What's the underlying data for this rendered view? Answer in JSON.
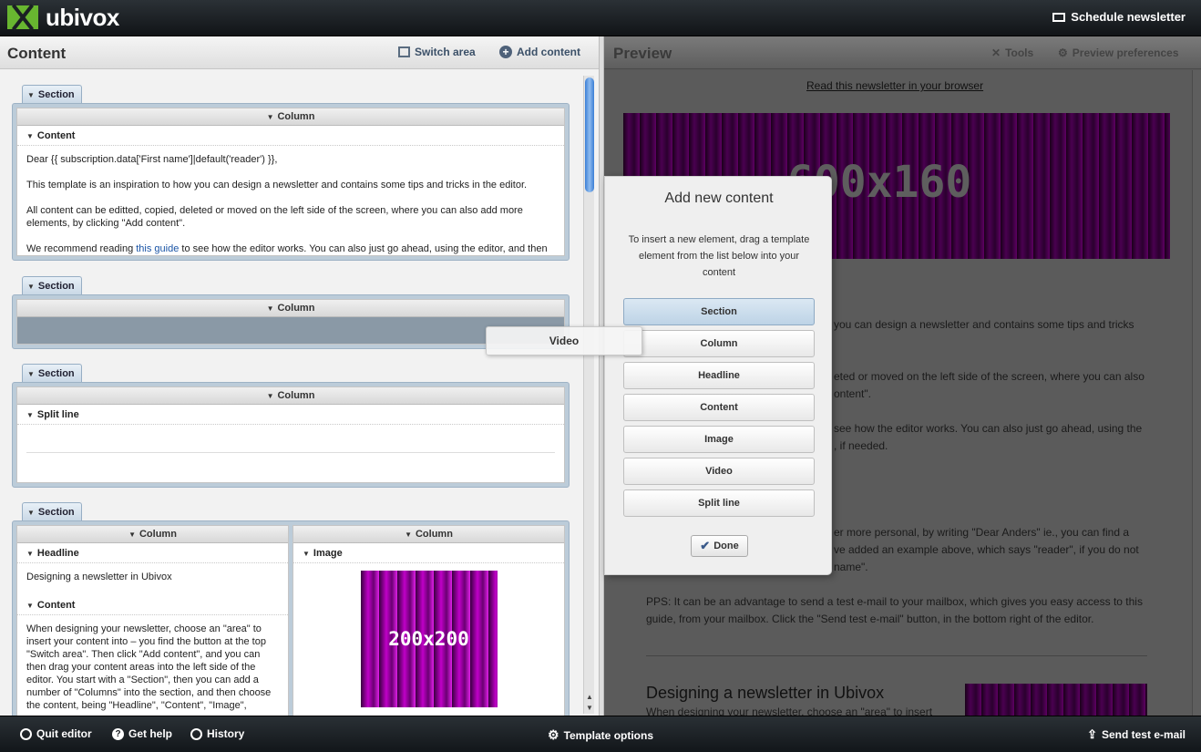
{
  "topbar": {
    "logo_text": "ubivox",
    "schedule_label": "Schedule newsletter"
  },
  "content_pane": {
    "title": "Content",
    "switch_area_label": "Switch area",
    "add_content_label": "Add content",
    "section_label": "Section",
    "column_label": "Column",
    "sections": {
      "s1": {
        "element_label": "Content",
        "para1": "Dear {{ subscription.data['First name']|default('reader') }},",
        "para2": "This template is an inspiration to how you can design a newsletter and contains some tips and tricks in the editor.",
        "para3": "All content can be editted, copied, deleted or moved on the left side of the screen, where you can also add more elements, by clicking \"Add content\".",
        "para4_pre": "We recommend reading ",
        "para4_link": "this guide",
        "para4_post": " to see how the editor works. You can also just go ahead, using the editor, and then"
      },
      "s3": {
        "element_label": "Split line"
      },
      "s4": {
        "headline_label": "Headline",
        "headline_text": "Designing a newsletter in Ubivox",
        "content_label": "Content",
        "content_text": "When designing your newsletter, choose an \"area\" to insert your content into – you find the button at the top \"Switch area\". Then click \"Add content\", and you can then drag your content areas into the left side of the editor. You start with a \"Section\", then you can add a number of \"Columns\" into the section, and then choose the content, being \"Headline\", \"Content\", \"Image\",",
        "image_label": "Image",
        "image_text": "200x200"
      }
    }
  },
  "preview_pane": {
    "title": "Preview",
    "tools_label": "Tools",
    "preferences_label": "Preview preferences",
    "browser_link": "Read this newsletter in your browser",
    "banner_text": "600x160",
    "text1": "you can design a newsletter and contains some tips and tricks",
    "text2": "eted or moved on the left side of the screen, where you can also",
    "text3": "ontent\".",
    "text4": "see how the editor works. You can also just go ahead, using the",
    "text5": ", if needed.",
    "text6": "er more personal, by writing \"Dear Anders\" ie., you can find a",
    "text7": "ve added an example above, which says \"reader\", if you do not",
    "text8": "name\".",
    "pps": "PPS: It can be an advantage to send a test e-mail to your mailbox, which gives you easy access to this guide, from your mailbox. Click the \"Send test e-mail\" button, in the bottom right of the editor.",
    "heading": "Designing a newsletter in Ubivox",
    "heading_sub": "When designing your newsletter, choose an \"area\" to insert"
  },
  "popup": {
    "title": "Add new content",
    "description": "To insert a new element, drag a template element from the list below into your content",
    "items": [
      "Section",
      "Column",
      "Headline",
      "Content",
      "Image",
      "Video",
      "Split line"
    ],
    "done_label": "Done",
    "drag_ghost": "Video"
  },
  "bottombar": {
    "quit_label": "Quit editor",
    "help_label": "Get help",
    "history_label": "History",
    "template_options_label": "Template options",
    "send_test_label": "Send test e-mail"
  }
}
